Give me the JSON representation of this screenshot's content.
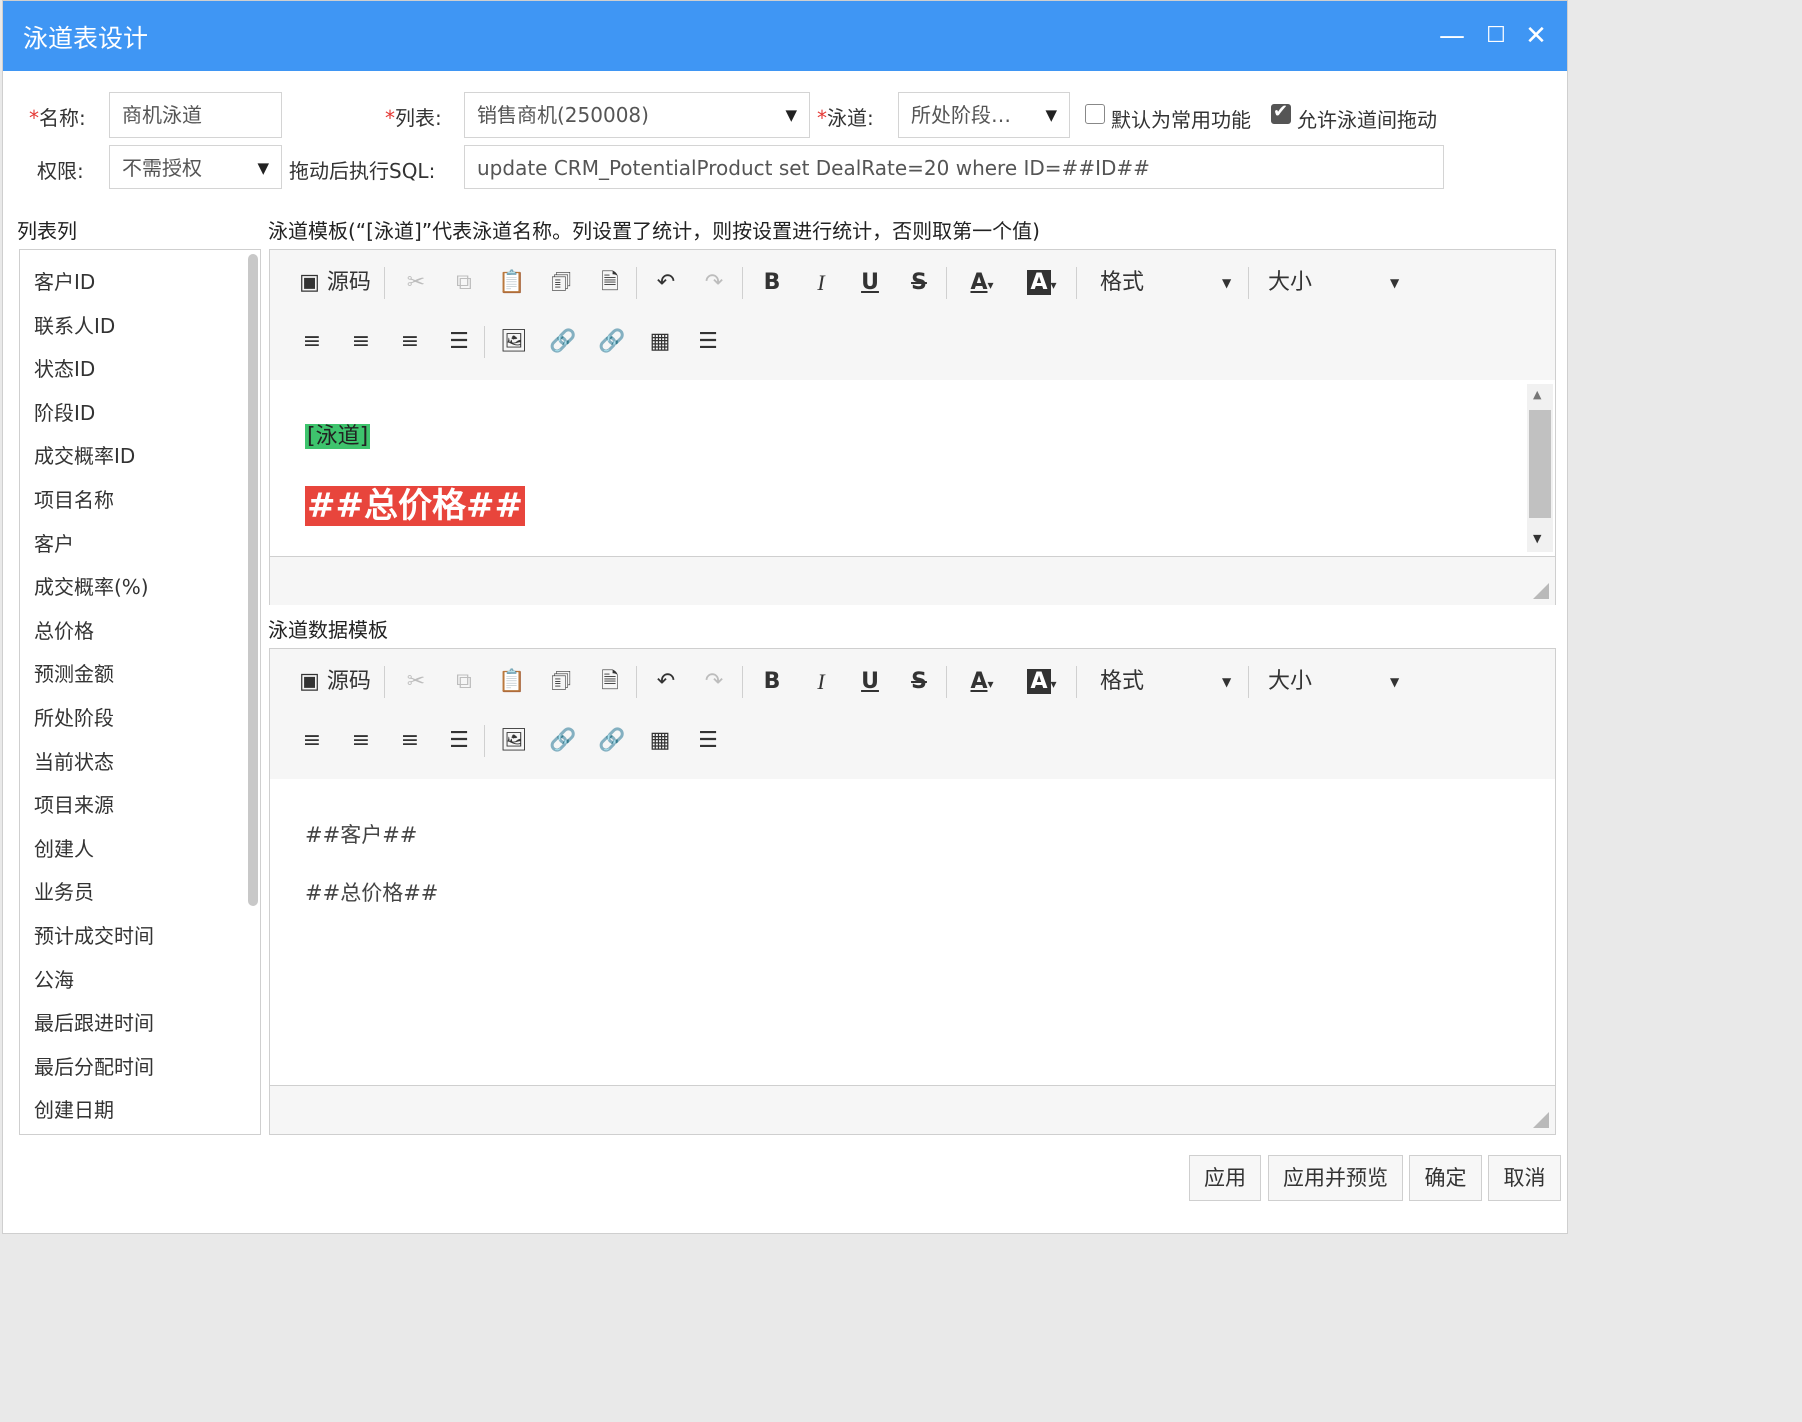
{
  "window": {
    "title": "泳道表设计"
  },
  "form": {
    "name_label": "名称:",
    "name_value": "商机泳道",
    "list_label": "列表:",
    "list_value": "销售商机(250008)",
    "lane_label": "泳道:",
    "lane_value": "所处阶段…",
    "default_label": "默认为常用功能",
    "default_checked": false,
    "drag_label": "允许泳道间拖动",
    "drag_checked": true,
    "perm_label": "权限:",
    "perm_value": "不需授权",
    "sql_label": "拖动后执行SQL:",
    "sql_value": "update CRM_PotentialProduct set DealRate=20 where ID=##ID##"
  },
  "columns": {
    "title": "列表列",
    "items": [
      "客户ID",
      "联系人ID",
      "状态ID",
      "阶段ID",
      "成交概率ID",
      "项目名称",
      "客户",
      "成交概率(%)",
      "总价格",
      "预测金额",
      "所处阶段",
      "当前状态",
      "项目来源",
      "创建人",
      "业务员",
      "预计成交时间",
      "公海",
      "最后跟进时间",
      "最后分配时间",
      "创建日期"
    ]
  },
  "lane_template": {
    "title": "泳道模板(“[泳道]”代表泳道名称。列设置了统计，则按设置进行统计，否则取第一个值)",
    "line1": "[泳道]",
    "line2": "##总价格##"
  },
  "data_template": {
    "title": "泳道数据模板",
    "line1": "##客户##",
    "line2": "##总价格##"
  },
  "toolbar": {
    "source_label": "源码",
    "format_label": "格式",
    "size_label": "大小"
  },
  "buttons": {
    "apply": "应用",
    "apply_preview": "应用并预览",
    "ok": "确定",
    "cancel": "取消"
  },
  "colors": {
    "titlebar": "#3f96f4",
    "lane_highlight": "#3ec46d",
    "price_highlight": "#e8453c"
  }
}
